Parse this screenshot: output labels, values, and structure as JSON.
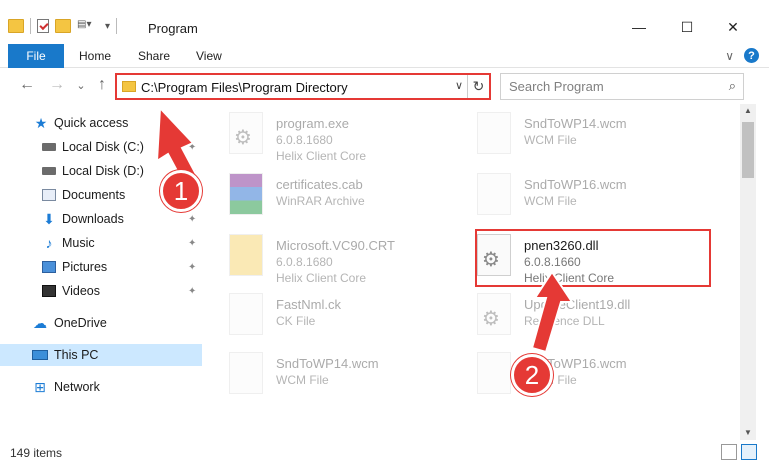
{
  "window": {
    "title": "Program",
    "minimize_glyph": "—",
    "maximize_glyph": "☐",
    "close_glyph": "✕"
  },
  "ribbon": {
    "tabs": [
      "File",
      "Home",
      "Share",
      "View"
    ],
    "help": "?",
    "collapse": "∨"
  },
  "nav": {
    "back": "←",
    "forward": "→",
    "recent": "⌄",
    "up": "↑",
    "address": "C:\\Program Files\\Program Directory",
    "dropdown": "∨",
    "refresh": "↻",
    "search_placeholder": "Search Program",
    "search_glyph": "⌕"
  },
  "sidebar": {
    "items": [
      {
        "label": "Quick access",
        "icon": "star-icon",
        "pinned": false
      },
      {
        "label": "Local Disk (C:)",
        "icon": "disk-icon",
        "pinned": true
      },
      {
        "label": "Local Disk (D:)",
        "icon": "disk-icon",
        "pinned": true
      },
      {
        "label": "Documents",
        "icon": "documents-icon",
        "pinned": true
      },
      {
        "label": "Downloads",
        "icon": "downloads-icon",
        "pinned": true
      },
      {
        "label": "Music",
        "icon": "music-icon",
        "pinned": true
      },
      {
        "label": "Pictures",
        "icon": "pictures-icon",
        "pinned": true
      },
      {
        "label": "Videos",
        "icon": "videos-icon",
        "pinned": true
      },
      {
        "label": "OneDrive",
        "icon": "onedrive-icon",
        "pinned": false
      },
      {
        "label": "This PC",
        "icon": "pc-icon",
        "pinned": false,
        "selected": true
      },
      {
        "label": "Network",
        "icon": "network-icon",
        "pinned": false
      }
    ],
    "pin_glyph": "✦"
  },
  "files": [
    {
      "name": "program.exe",
      "line1": "6.0.8.1680",
      "line2": "Helix Client Core",
      "icon": "exe-file-icon",
      "faded": true
    },
    {
      "name": "SndToWP14.wcm",
      "line1": "WCM File",
      "line2": "",
      "icon": "blank-file-icon",
      "faded": true
    },
    {
      "name": "certificates.cab",
      "line1": "WinRAR Archive",
      "line2": "",
      "icon": "archive-file-icon",
      "faded": true
    },
    {
      "name": "SndToWP16.wcm",
      "line1": "WCM File",
      "line2": "",
      "icon": "blank-file-icon",
      "faded": true
    },
    {
      "name": "Microsoft.VC90.CRT",
      "line1": "6.0.8.1680",
      "line2": "Helix Client Core",
      "icon": "folder-icon",
      "faded": true
    },
    {
      "name": "pnen3260.dll",
      "line1": "6.0.8.1660",
      "line2": "Helix Client Core",
      "icon": "dll-file-icon",
      "faded": false
    },
    {
      "name": "FastNml.ck",
      "line1": "CK File",
      "line2": "",
      "icon": "blank-file-icon",
      "faded": true
    },
    {
      "name": "UpdateClient19.dll",
      "line1": "Reference DLL",
      "line2": "",
      "icon": "dll-file-icon",
      "faded": true
    },
    {
      "name": "SndToWP14.wcm",
      "line1": "WCM File",
      "line2": "",
      "icon": "blank-file-icon",
      "faded": true
    },
    {
      "name": "SndToWP16.wcm",
      "line1": "WCM File",
      "line2": "",
      "icon": "blank-file-icon",
      "faded": true
    }
  ],
  "status": {
    "item_count": "149 items"
  },
  "callouts": {
    "step1": "1",
    "step2": "2",
    "color": "#e53935"
  },
  "colors": {
    "accent": "#1979ca",
    "selection": "#cce8ff",
    "highlight": "#e53935"
  }
}
